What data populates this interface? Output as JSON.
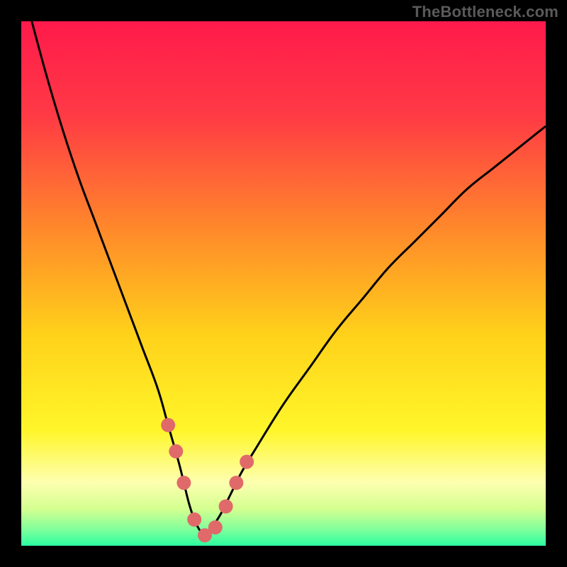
{
  "watermark": "TheBottleneck.com",
  "chart_data": {
    "type": "line",
    "title": "",
    "xlabel": "",
    "ylabel": "",
    "xlim": [
      0,
      100
    ],
    "ylim": [
      0,
      100
    ],
    "series": [
      {
        "name": "curve",
        "x": [
          2,
          5,
          8,
          11,
          14,
          17,
          20,
          23,
          26,
          28,
          30,
          31,
          32,
          33,
          34,
          35,
          36,
          38,
          40,
          42,
          45,
          50,
          55,
          60,
          65,
          70,
          75,
          80,
          85,
          90,
          95,
          100
        ],
        "y": [
          100,
          89,
          79,
          70,
          62,
          54,
          46,
          38,
          30,
          23,
          16,
          12,
          8,
          5,
          3,
          2,
          3,
          6,
          10,
          14,
          19,
          27,
          34,
          41,
          47,
          53,
          58,
          63,
          68,
          72,
          76,
          80
        ]
      }
    ],
    "markers": {
      "name": "highlight-points",
      "x": [
        28,
        29.5,
        31,
        33,
        35,
        37,
        39,
        41,
        43
      ],
      "y": [
        23,
        18,
        12,
        5,
        2,
        3.5,
        7.5,
        12,
        16
      ]
    },
    "gradient_stops": [
      {
        "offset": 0.0,
        "color": "#ff1a4b"
      },
      {
        "offset": 0.18,
        "color": "#ff3a45"
      },
      {
        "offset": 0.4,
        "color": "#ff8a2a"
      },
      {
        "offset": 0.6,
        "color": "#ffd21a"
      },
      {
        "offset": 0.78,
        "color": "#fff62a"
      },
      {
        "offset": 0.88,
        "color": "#fdffb0"
      },
      {
        "offset": 0.93,
        "color": "#d4ff90"
      },
      {
        "offset": 0.97,
        "color": "#7dff9c"
      },
      {
        "offset": 1.0,
        "color": "#2bffa0"
      }
    ],
    "curve_color": "#000000",
    "marker_color": "#e06a6a",
    "marker_radius_px": 10
  }
}
